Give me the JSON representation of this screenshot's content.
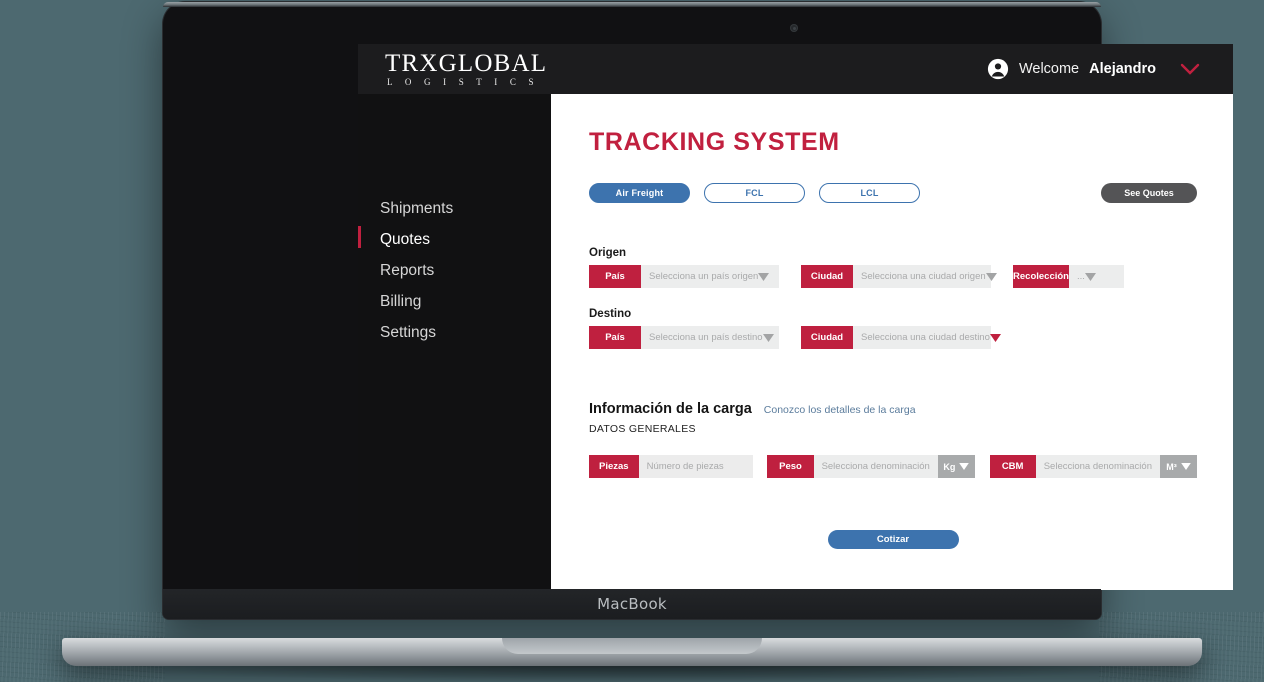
{
  "device": {
    "chin_label": "MacBook",
    "camera_icon": "camera-dot"
  },
  "colors": {
    "brand_red": "#bf203f",
    "accent_blue": "#3d73ae",
    "topbar_black": "#1c1c1e",
    "sidebar_black": "#111112",
    "desktop_bg": "#4d6970",
    "grey_button": "#545456"
  },
  "topbar": {
    "logo_main": "TRXGLOBAL",
    "logo_sub": "L O G I S T I C S",
    "avatar_icon": "user-avatar-icon",
    "welcome_label": "Welcome",
    "user_name": "Alejandro",
    "chevron_icon": "chevron-down-icon"
  },
  "sidebar": {
    "items": [
      {
        "label": "Shipments",
        "active": false
      },
      {
        "label": "Quotes",
        "active": true
      },
      {
        "label": "Reports",
        "active": false
      },
      {
        "label": "Billing",
        "active": false
      },
      {
        "label": "Settings",
        "active": false
      }
    ]
  },
  "main": {
    "page_title": "TRACKING SYSTEM",
    "tabs": [
      {
        "label": "Air Freight",
        "active": true
      },
      {
        "label": "FCL",
        "active": false
      },
      {
        "label": "LCL",
        "active": false
      }
    ],
    "see_quotes_label": "See Quotes",
    "origen": {
      "group_label": "Origen",
      "pais_tag": "País",
      "pais_placeholder": "Selecciona un país origen",
      "ciudad_tag": "Ciudad",
      "ciudad_placeholder": "Selecciona una ciudad origen",
      "recoleccion_tag": "Recolección",
      "recoleccion_placeholder": "..."
    },
    "destino": {
      "group_label": "Destino",
      "pais_tag": "País",
      "pais_placeholder": "Selecciona un país destino",
      "ciudad_tag": "Ciudad",
      "ciudad_placeholder": "Selecciona una ciudad destino"
    },
    "cargo": {
      "title": "Información de la carga",
      "link": "Conozco los detalles de la carga",
      "subtitle": "DATOS GENERALES",
      "piezas_tag": "Piezas",
      "piezas_placeholder": "Número de piezas",
      "peso_tag": "Peso",
      "peso_placeholder": "Selecciona denominación",
      "peso_unit": "Kg",
      "cbm_tag": "CBM",
      "cbm_placeholder": "Selecciona denominación",
      "cbm_unit": "M³"
    },
    "submit_label": "Cotizar",
    "dropdown_icon": "caret-down-icon"
  }
}
